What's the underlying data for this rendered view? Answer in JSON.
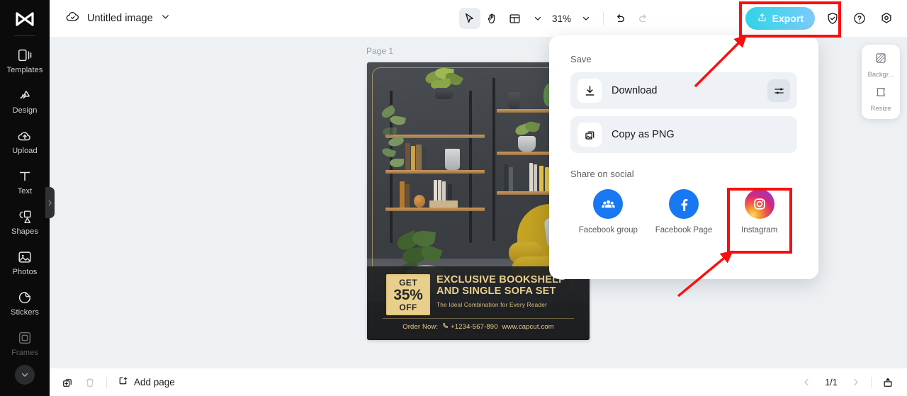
{
  "app": {
    "document_title": "Untitled image",
    "cloud_icon": "cloud-check-icon",
    "title_chevron": "chevron-down-icon"
  },
  "toolbar": {
    "select_tool": "cursor-arrow-icon",
    "hand_tool": "hand-icon",
    "layout_tool": "layout-grid-icon",
    "layout_chevron": "chevron-down-icon",
    "zoom_level": "31%",
    "zoom_chevron": "chevron-down-icon",
    "undo": "undo-arrow-icon",
    "redo": "redo-arrow-icon",
    "export_label": "Export",
    "export_icon": "upload-box-icon",
    "export_color": "#4fd3ef",
    "shield_icon": "shield-check-icon",
    "help_icon": "question-circle-icon",
    "settings_icon": "gear-hexagon-icon"
  },
  "sidebar": {
    "logo": "capcut-logo-icon",
    "collapse_handle": "chevron-right-icon",
    "items": [
      {
        "label": "Templates",
        "icon": "templates-icon",
        "dim": false
      },
      {
        "label": "Design",
        "icon": "design-icon",
        "dim": false
      },
      {
        "label": "Upload",
        "icon": "upload-cloud-icon",
        "dim": false
      },
      {
        "label": "Text",
        "icon": "text-t-icon",
        "dim": false
      },
      {
        "label": "Shapes",
        "icon": "shapes-icon",
        "dim": false
      },
      {
        "label": "Photos",
        "icon": "photos-image-icon",
        "dim": false
      },
      {
        "label": "Stickers",
        "icon": "stickers-icon",
        "dim": false
      },
      {
        "label": "Frames",
        "icon": "frames-icon",
        "dim": true
      }
    ],
    "more_chevron": "chevron-down-icon"
  },
  "canvas": {
    "page_label": "Page 1"
  },
  "poster": {
    "badge_line1": "GET",
    "badge_line2": "35%",
    "badge_line3": "OFF",
    "headline_line1": "EXCLUSIVE BOOKSHELF",
    "headline_line2": "AND SINGLE SOFA SET",
    "subtitle": "The Ideal Combination for Every Reader",
    "order_label": "Order Now:",
    "phone_icon": "phone-icon",
    "phone": "+1234-567-890",
    "website": "www.capcut.com",
    "accent_color": "#e8cf8c"
  },
  "export_panel": {
    "save_section_label": "Save",
    "save_options": [
      {
        "label": "Download",
        "icon": "download-arrow-icon",
        "has_settings": true,
        "settings_icon": "sliders-icon"
      },
      {
        "label": "Copy as PNG",
        "icon": "copy-image-icon",
        "has_settings": false,
        "settings_icon": ""
      }
    ],
    "social_section_label": "Share on social",
    "socials": [
      {
        "label": "Facebook group",
        "icon": "facebook-group-icon",
        "color": "#1877f2"
      },
      {
        "label": "Facebook Page",
        "icon": "facebook-page-icon",
        "color": "#1877f2"
      },
      {
        "label": "Instagram",
        "icon": "instagram-icon",
        "color": "#d62976"
      }
    ]
  },
  "right_panel": {
    "items": [
      {
        "label": "Backgr...",
        "icon": "background-icon"
      },
      {
        "label": "Resize",
        "icon": "resize-icon"
      }
    ]
  },
  "bottombar": {
    "duplicate_icon": "duplicate-page-icon",
    "delete_icon": "trash-icon",
    "add_page_icon": "add-page-icon",
    "add_page_label": "Add page",
    "prev_icon": "chevron-left-icon",
    "page_indicator": "1/1",
    "next_icon": "chevron-right-icon",
    "present_icon": "present-export-icon"
  },
  "annotations": {
    "highlight_color": "#fc0d0d",
    "boxes": [
      {
        "target": "Export"
      },
      {
        "target": "Instagram"
      }
    ],
    "arrows": [
      {
        "from": "export-panel",
        "to": "export-button"
      },
      {
        "from": "canvas-lower",
        "to": "instagram-option"
      }
    ]
  }
}
